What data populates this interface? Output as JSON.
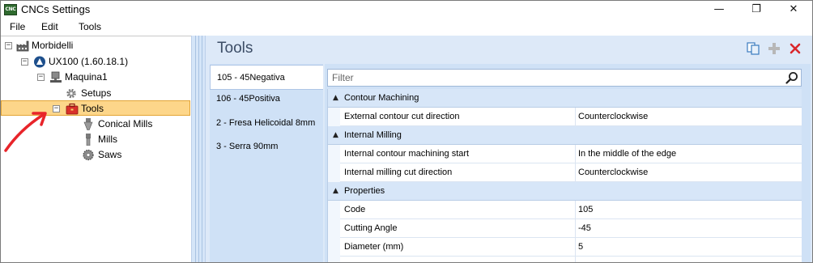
{
  "window": {
    "title": "CNCs Settings",
    "app_icon_text": "CNC",
    "minimize_glyph": "—",
    "maximize_glyph": "❐",
    "close_glyph": "✕"
  },
  "menu": {
    "items": [
      "File",
      "Edit",
      "Tools"
    ]
  },
  "tree": {
    "root": {
      "label": "Morbidelli",
      "expanded_glyph": "−"
    },
    "machine": {
      "label": "UX100 (1.60.18.1)",
      "expanded_glyph": "−"
    },
    "maquina": {
      "label": "Maquina1",
      "expanded_glyph": "−"
    },
    "setups": {
      "label": "Setups"
    },
    "tools": {
      "label": "Tools",
      "expanded_glyph": "−"
    },
    "conical": {
      "label": "Conical Mills"
    },
    "mills": {
      "label": "Mills"
    },
    "saws": {
      "label": "Saws"
    }
  },
  "right_panel": {
    "title": "Tools",
    "accent_delete": "#d9262b",
    "tool_list": [
      "105 - 45Negativa",
      "106 - 45Positiva",
      "2 - Fresa Helicoidal 8mm",
      "3 - Serra 90mm"
    ],
    "selected_tool_index": 0,
    "filter_placeholder": "Filter"
  },
  "grid": {
    "categories": [
      {
        "label": "Contour Machining",
        "toggle": "▲",
        "props": [
          {
            "name": "External contour cut direction",
            "value": "Counterclockwise"
          }
        ]
      },
      {
        "label": "Internal Milling",
        "toggle": "▲",
        "props": [
          {
            "name": "Internal contour machining start",
            "value": "In the middle of the edge"
          },
          {
            "name": "Internal milling cut direction",
            "value": "Counterclockwise"
          }
        ]
      },
      {
        "label": "Properties",
        "toggle": "▲",
        "props": [
          {
            "name": "Code",
            "value": "105"
          },
          {
            "name": "Cutting Angle",
            "value": "-45"
          },
          {
            "name": "Diameter (mm)",
            "value": "5"
          }
        ]
      }
    ]
  },
  "annotation": {
    "arrow_color": "#e8242a"
  }
}
